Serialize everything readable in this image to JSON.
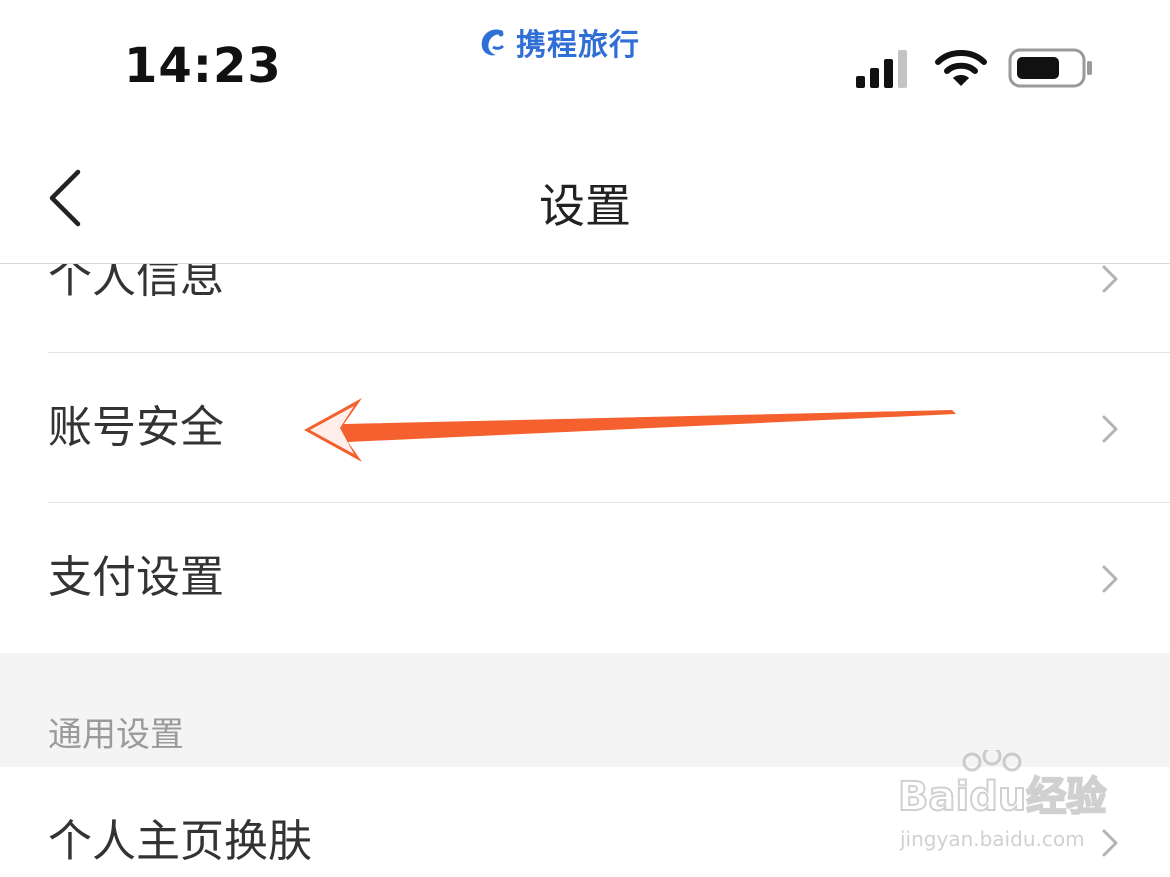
{
  "status_bar": {
    "time": "14:23",
    "brand": "携程旅行",
    "icons": [
      "signal-icon",
      "wifi-icon",
      "battery-icon"
    ]
  },
  "nav": {
    "title": "设置",
    "back_icon": "chevron-left-icon"
  },
  "list": {
    "items": [
      {
        "label": "个人信息"
      },
      {
        "label": "账号安全"
      },
      {
        "label": "支付设置"
      }
    ],
    "section_header": "通用设置",
    "items2": [
      {
        "label": "个人主页换肤"
      }
    ]
  },
  "annotation": {
    "arrow_color": "#f4602e",
    "points_to": "账号安全"
  },
  "watermark": {
    "text": "Baidu经验",
    "url": "jingyan.baidu.com"
  },
  "colors": {
    "brand": "#2f6fd6",
    "section_bg": "#f4f4f4",
    "section_text": "#9a9a9a",
    "arrow": "#f4602e"
  }
}
